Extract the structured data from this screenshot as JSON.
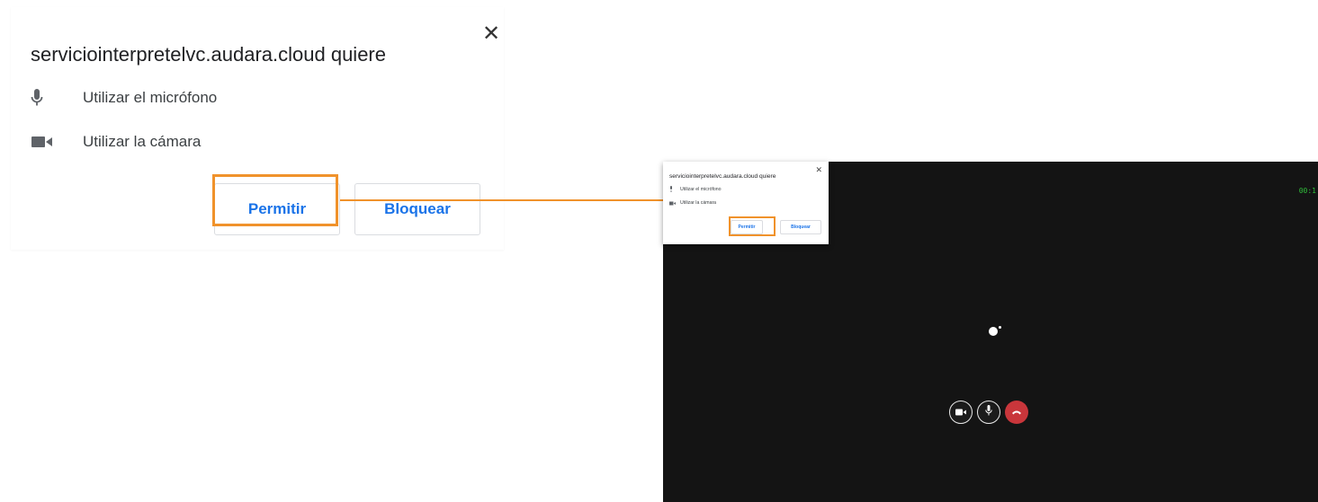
{
  "big_prompt": {
    "title": "serviciointerpretelvc.audara.cloud quiere",
    "close_symbol": "✕",
    "permissions": [
      {
        "icon": "microphone-icon",
        "label": "Utilizar el micrófono"
      },
      {
        "icon": "camera-icon",
        "label": "Utilizar la cámara"
      }
    ],
    "allow_label": "Permitir",
    "block_label": "Bloquear"
  },
  "small_prompt": {
    "title": "serviciointerpretelvc.audara.cloud quiere",
    "close_symbol": "✕",
    "permissions": [
      {
        "icon": "microphone-icon",
        "label": "Utilizar el micrófono"
      },
      {
        "icon": "camera-icon",
        "label": "Utilizar la cámara"
      }
    ],
    "allow_label": "Permitir",
    "block_label": "Bloquear"
  },
  "video_call": {
    "timer": "00:1",
    "controls": [
      {
        "icon": "camera-icon"
      },
      {
        "icon": "microphone-icon"
      },
      {
        "icon": "hang-up-icon"
      }
    ]
  },
  "colors": {
    "highlight": "#f0922b",
    "button_text": "#1a73e8",
    "hang_up": "#c9363b",
    "video_background": "#141414",
    "timer": "#2fbf3a"
  }
}
